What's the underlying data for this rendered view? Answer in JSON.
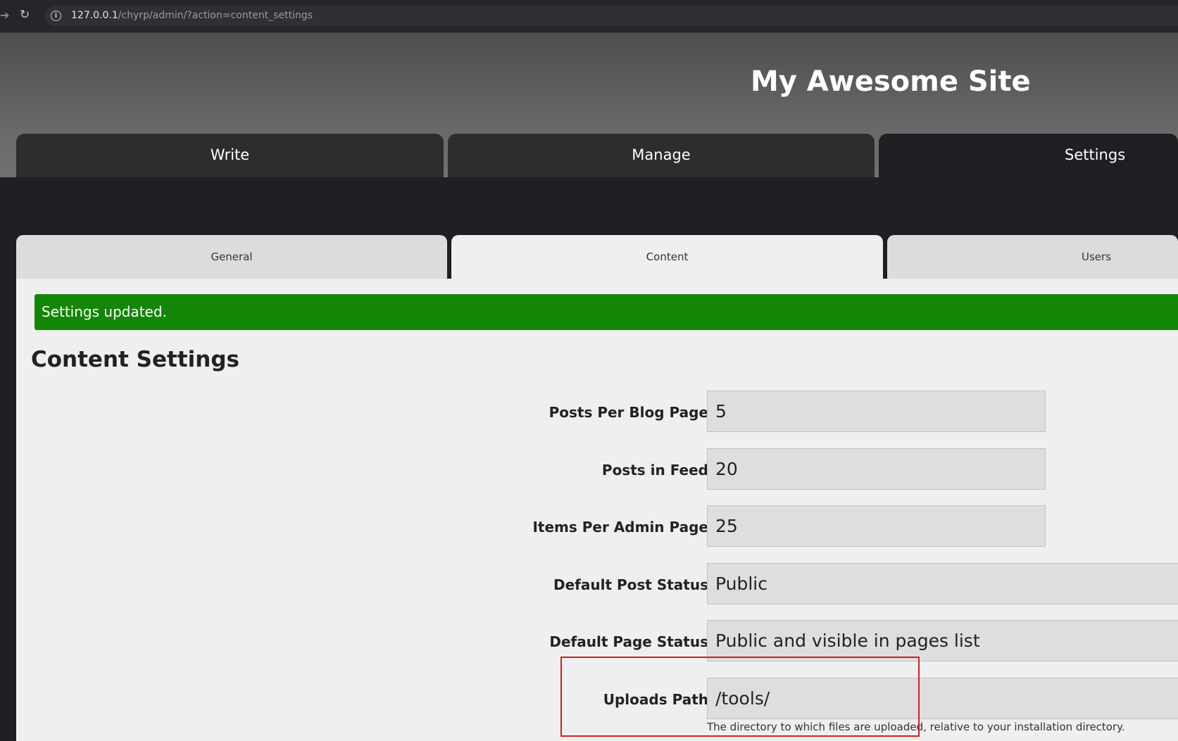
{
  "browser": {
    "url_host": "127.0.0.1",
    "url_path": "/chyrp/admin/?action=content_settings"
  },
  "header": {
    "site_title": "My Awesome Site",
    "tabs": [
      {
        "label": "Write",
        "active": false
      },
      {
        "label": "Manage",
        "active": false
      },
      {
        "label": "Settings",
        "active": true
      }
    ]
  },
  "subtabs": [
    {
      "label": "General",
      "active": false
    },
    {
      "label": "Content",
      "active": true
    },
    {
      "label": "Users",
      "active": false
    }
  ],
  "flash": {
    "message": "Settings updated.",
    "color": "#138606"
  },
  "main": {
    "title": "Content Settings",
    "fields": [
      {
        "label": "Posts Per Blog Page",
        "value": "5"
      },
      {
        "label": "Posts in Feed",
        "value": "20"
      },
      {
        "label": "Items Per Admin Page",
        "value": "25"
      },
      {
        "label": "Default Post Status",
        "value": "Public"
      },
      {
        "label": "Default Page Status",
        "value": "Public and visible in pages list"
      },
      {
        "label": "Uploads Path",
        "value": "/tools/",
        "help": "The directory to which files are uploaded, relative to your installation directory."
      }
    ]
  },
  "annotation": {
    "highlight_color": "#cc2222"
  }
}
